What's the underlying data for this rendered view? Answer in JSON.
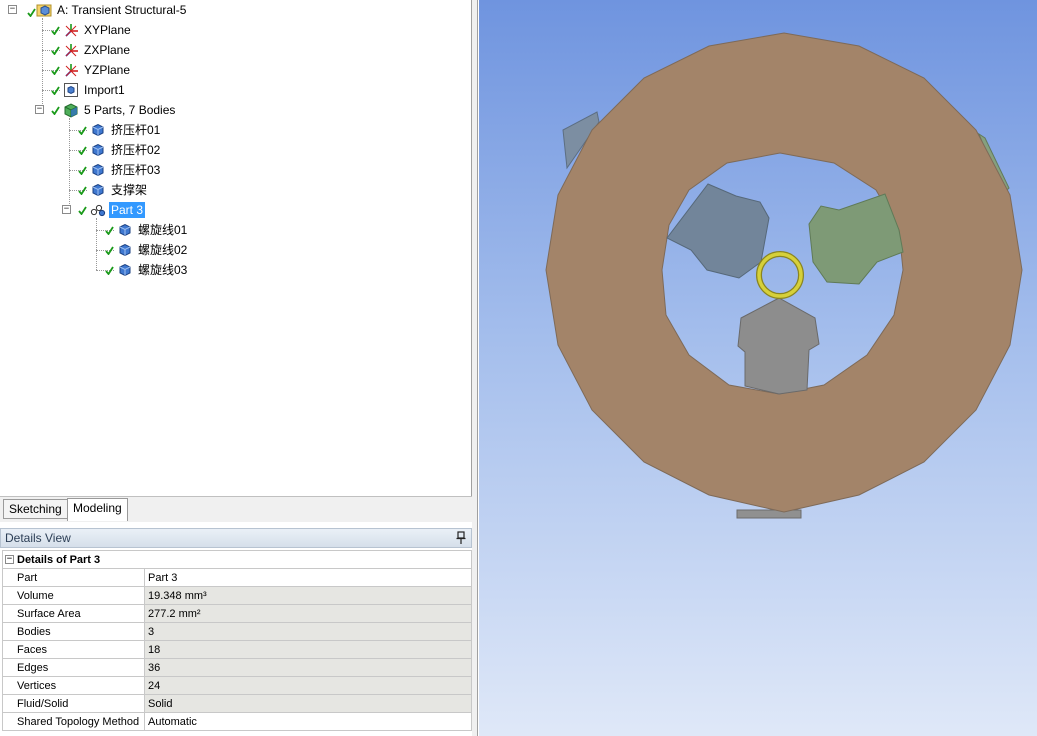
{
  "tree": {
    "root": {
      "label": "A: Transient Structural-5",
      "expanded": "−"
    },
    "planes": [
      {
        "label": "XYPlane"
      },
      {
        "label": "ZXPlane"
      },
      {
        "label": "YZPlane"
      }
    ],
    "import": {
      "label": "Import1"
    },
    "parts_group": {
      "label": "5 Parts, 7 Bodies",
      "expanded": "−"
    },
    "bodies": [
      {
        "label": "挤压杆01"
      },
      {
        "label": "挤压杆02"
      },
      {
        "label": "挤压杆03"
      },
      {
        "label": "支撑架"
      }
    ],
    "part3": {
      "label": "Part 3",
      "expanded": "−"
    },
    "part3_bodies": [
      {
        "label": "螺旋线01"
      },
      {
        "label": "螺旋线02"
      },
      {
        "label": "螺旋线03"
      }
    ]
  },
  "tabs": [
    {
      "label": "Sketching"
    },
    {
      "label": "Modeling"
    }
  ],
  "details": {
    "header": "Details View",
    "group_label": "Details of Part 3",
    "group_expanded": "−",
    "rows": [
      {
        "key": "Part",
        "value": "Part 3"
      },
      {
        "key": "Volume",
        "value": "19.348 mm³"
      },
      {
        "key": "Surface Area",
        "value": "277.2 mm²"
      },
      {
        "key": "Bodies",
        "value": "3"
      },
      {
        "key": "Faces",
        "value": "18"
      },
      {
        "key": "Edges",
        "value": "36"
      },
      {
        "key": "Vertices",
        "value": "24"
      },
      {
        "key": "Fluid/Solid",
        "value": "Solid"
      },
      {
        "key": "Shared Topology Method",
        "value": "Automatic"
      }
    ]
  },
  "colors": {
    "ring": "#a38469",
    "ring_edge": "#7e6a58",
    "arm_left": "#72859a",
    "arm_right": "#7e9a76",
    "arm_bottom": "#8d8d8d",
    "helix": "#c8c232",
    "selection": "#3399ff"
  }
}
